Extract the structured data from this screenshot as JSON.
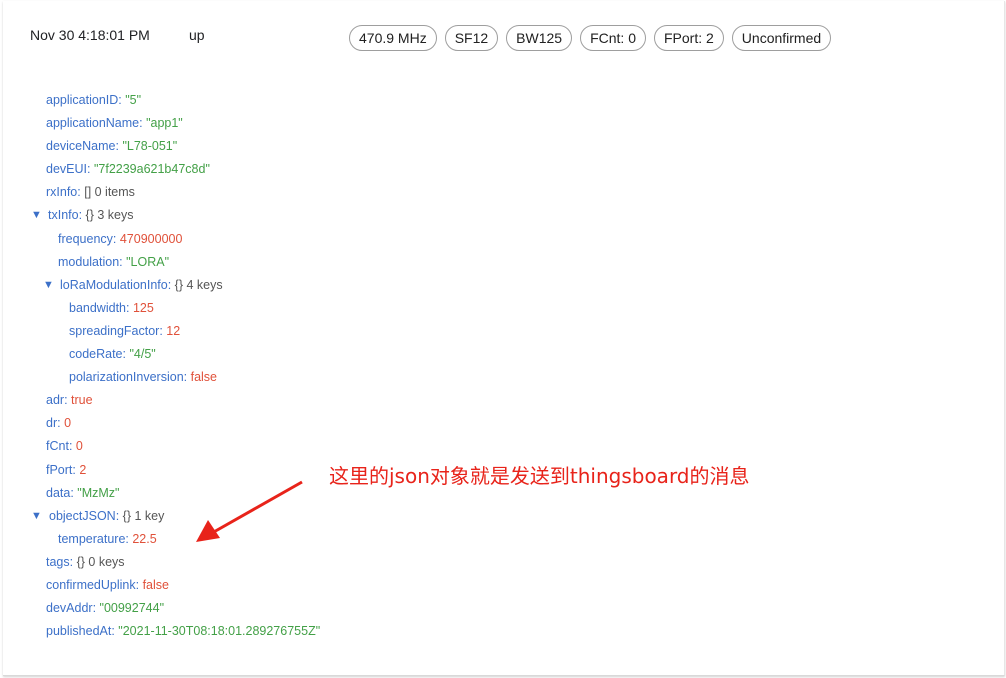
{
  "header": {
    "timestamp": "Nov 30 4:18:01 PM",
    "direction": "up",
    "chips": [
      "470.9 MHz",
      "SF12",
      "BW125",
      "FCnt: 0",
      "FPort: 2",
      "Unconfirmed"
    ]
  },
  "tree": {
    "applicationID": {
      "key": "applicationID",
      "value": "\"5\""
    },
    "applicationName": {
      "key": "applicationName",
      "value": "\"app1\""
    },
    "deviceName": {
      "key": "deviceName",
      "value": "\"L78-051\""
    },
    "devEUI": {
      "key": "devEUI",
      "value": "\"7f2239a621b47c8d\""
    },
    "rxInfo": {
      "key": "rxInfo",
      "meta": "[]  0 items"
    },
    "txInfo": {
      "key": "txInfo",
      "meta": "{}  3 keys",
      "frequency": {
        "key": "frequency",
        "value": "470900000"
      },
      "modulation": {
        "key": "modulation",
        "value": "\"LORA\""
      },
      "loRaModulationInfo": {
        "key": "loRaModulationInfo",
        "meta": "{}  4 keys",
        "bandwidth": {
          "key": "bandwidth",
          "value": "125"
        },
        "spreadingFactor": {
          "key": "spreadingFactor",
          "value": "12"
        },
        "codeRate": {
          "key": "codeRate",
          "value": "\"4/5\""
        },
        "polarizationInversion": {
          "key": "polarizationInversion",
          "value": "false"
        }
      }
    },
    "adr": {
      "key": "adr",
      "value": "true"
    },
    "dr": {
      "key": "dr",
      "value": "0"
    },
    "fCnt": {
      "key": "fCnt",
      "value": "0"
    },
    "fPort": {
      "key": "fPort",
      "value": "2"
    },
    "data": {
      "key": "data",
      "value": "\"MzMz\""
    },
    "objectJSON": {
      "key": "objectJSON",
      "meta": "{}  1 key",
      "temperature": {
        "key": "temperature",
        "value": "22.5"
      }
    },
    "tags": {
      "key": "tags",
      "meta": "{}  0 keys"
    },
    "confirmedUplink": {
      "key": "confirmedUplink",
      "value": "false"
    },
    "devAddr": {
      "key": "devAddr",
      "value": "\"00992744\""
    },
    "publishedAt": {
      "key": "publishedAt",
      "value": "\"2021-11-30T08:18:01.289276755Z\""
    }
  },
  "annotation": "这里的json对象就是发送到thingsboard的消息",
  "colors": {
    "key": "#3c70c8",
    "string": "#43a047",
    "number": "#e0513a",
    "annotation": "#e8231a"
  }
}
